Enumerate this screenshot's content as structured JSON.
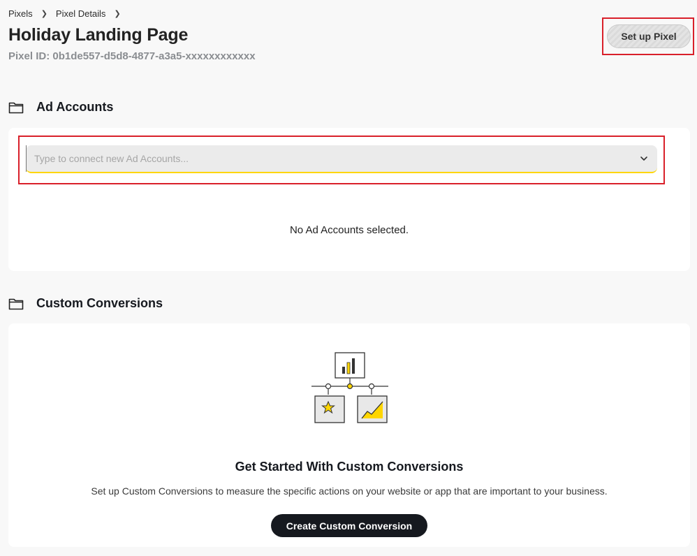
{
  "breadcrumb": {
    "items": [
      "Pixels",
      "Pixel Details"
    ],
    "separator": ">"
  },
  "header": {
    "title": "Holiday Landing Page",
    "pixel_id": "Pixel ID: 0b1de557-d5d8-4877-a3a5-xxxxxxxxxxxx",
    "setup_button": "Set up Pixel"
  },
  "ad_accounts": {
    "heading": "Ad Accounts",
    "input_placeholder": "Type to connect new Ad Accounts...",
    "input_value": "",
    "empty_message": "No Ad Accounts selected."
  },
  "custom_conversions": {
    "heading": "Custom Conversions",
    "title": "Get Started With Custom Conversions",
    "description": "Set up Custom Conversions to measure the specific actions on your website or app that are important to your business.",
    "button": "Create Custom Conversion"
  },
  "colors": {
    "accent": "#ffd600",
    "primary_button": "#16191f",
    "highlight_box": "#d9202a"
  },
  "icons": {
    "folder": "folder-icon",
    "chevron": "chevron-down-icon",
    "breadcrumb_separator": "chevron-right-icon"
  }
}
